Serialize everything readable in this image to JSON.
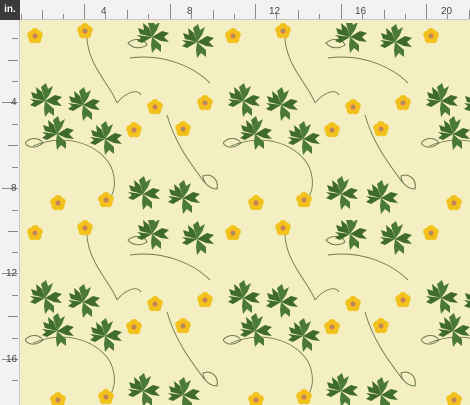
{
  "ruler": {
    "unit": "in.",
    "top_labels": [
      "4",
      "8",
      "12",
      "16",
      "20"
    ],
    "left_labels": [
      "4",
      "8",
      "12",
      "16"
    ]
  },
  "preview": {
    "pattern": "botanical buttercup floral repeat",
    "background_color": "#f4eec3",
    "flower_color": "#f2c21c",
    "flower_center_color": "#e07a4f",
    "leaf_color": "#3f6b2e",
    "stem_color": "#6d7a4e"
  }
}
